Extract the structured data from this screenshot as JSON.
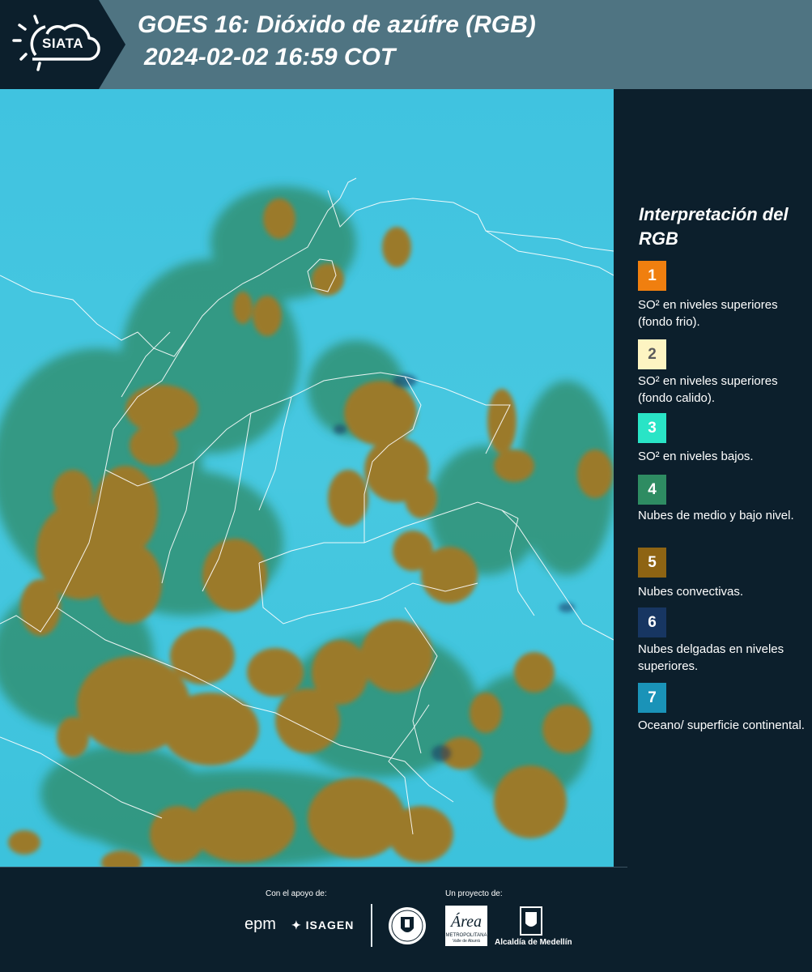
{
  "header": {
    "logo_text": "SIATA",
    "title_line1": "GOES 16: Dióxido de azúfre (RGB)",
    "title_line2": " 2024-02-02 16:59 COT",
    "background_color": "#4f7482"
  },
  "map": {
    "ocean_color": "#3fc4df",
    "convective_color": "#9b7a2c",
    "mid_level_color": "#2f8a66",
    "boundary_color": "#ffffff"
  },
  "legend": {
    "title": "Interpretación del RGB",
    "items": [
      {
        "number": "1",
        "label": "SO² en niveles superiores (fondo frio).",
        "color": "#f07f0f",
        "text_color": "#ffffff"
      },
      {
        "number": "2",
        "label": "SO² en niveles superiores (fondo calido).",
        "color": "#fdf4c2",
        "text_color": "#5b5b5b"
      },
      {
        "number": "3",
        "label": "SO² en niveles bajos.",
        "color": "#29e4c6",
        "text_color": "#ffffff"
      },
      {
        "number": "4",
        "label": "Nubes de medio y bajo nivel.",
        "color": "#2e8c62",
        "text_color": "#ffffff"
      },
      {
        "number": "5",
        "label": "Nubes convectivas.",
        "color": "#8e6413",
        "text_color": "#ffffff"
      },
      {
        "number": "6",
        "label": "Nubes delgadas en niveles superiores.",
        "color": "#173662",
        "text_color": "#ffffff"
      },
      {
        "number": "7",
        "label": "Oceano/ superficie continental.",
        "color": "#1a93b8",
        "text_color": "#ffffff"
      }
    ]
  },
  "footer": {
    "support_label": "Con el apoyo de:",
    "project_label": "Un proyecto de:",
    "epm": "epm",
    "isagen": "ISAGEN",
    "alcaldia": "Alcaldía de Medellín",
    "area_script": "Área",
    "area_sub": "METROPOLITANA",
    "area_sub2": "Valle de Aburrá"
  }
}
